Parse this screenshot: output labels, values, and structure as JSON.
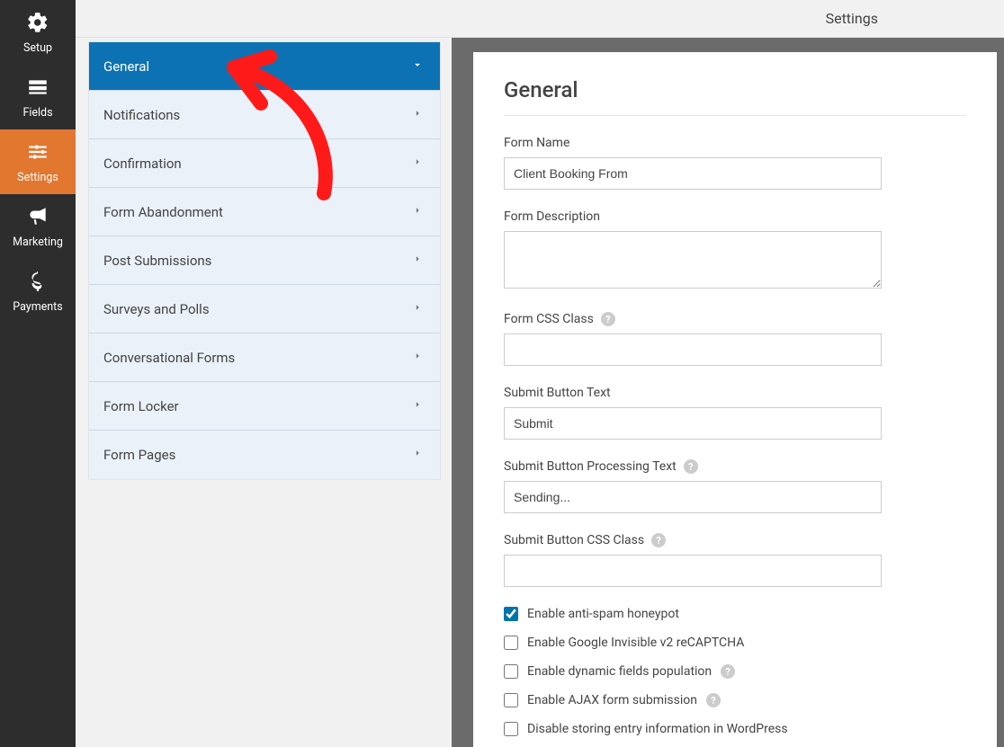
{
  "topbar": {
    "title": "Settings"
  },
  "leftnav": {
    "items": [
      {
        "label": "Setup"
      },
      {
        "label": "Fields"
      },
      {
        "label": "Settings"
      },
      {
        "label": "Marketing"
      },
      {
        "label": "Payments"
      }
    ]
  },
  "settings_panel": {
    "items": [
      {
        "label": "General",
        "active": true
      },
      {
        "label": "Notifications"
      },
      {
        "label": "Confirmation"
      },
      {
        "label": "Form Abandonment"
      },
      {
        "label": "Post Submissions"
      },
      {
        "label": "Surveys and Polls"
      },
      {
        "label": "Conversational Forms"
      },
      {
        "label": "Form Locker"
      },
      {
        "label": "Form Pages"
      }
    ]
  },
  "content": {
    "heading": "General",
    "fields": {
      "form_name": {
        "label": "Form Name",
        "value": "Client Booking From"
      },
      "form_description": {
        "label": "Form Description",
        "value": ""
      },
      "form_css_class": {
        "label": "Form CSS Class",
        "value": ""
      },
      "submit_button_text": {
        "label": "Submit Button Text",
        "value": "Submit"
      },
      "submit_button_processing_text": {
        "label": "Submit Button Processing Text",
        "value": "Sending..."
      },
      "submit_button_css_class": {
        "label": "Submit Button CSS Class",
        "value": ""
      }
    },
    "checkboxes": [
      {
        "label": "Enable anti-spam honeypot",
        "checked": true
      },
      {
        "label": "Enable Google Invisible v2 reCAPTCHA",
        "checked": false
      },
      {
        "label": "Enable dynamic fields population",
        "checked": false,
        "help": true
      },
      {
        "label": "Enable AJAX form submission",
        "checked": false,
        "help": true
      },
      {
        "label": "Disable storing entry information in WordPress",
        "checked": false
      }
    ]
  }
}
